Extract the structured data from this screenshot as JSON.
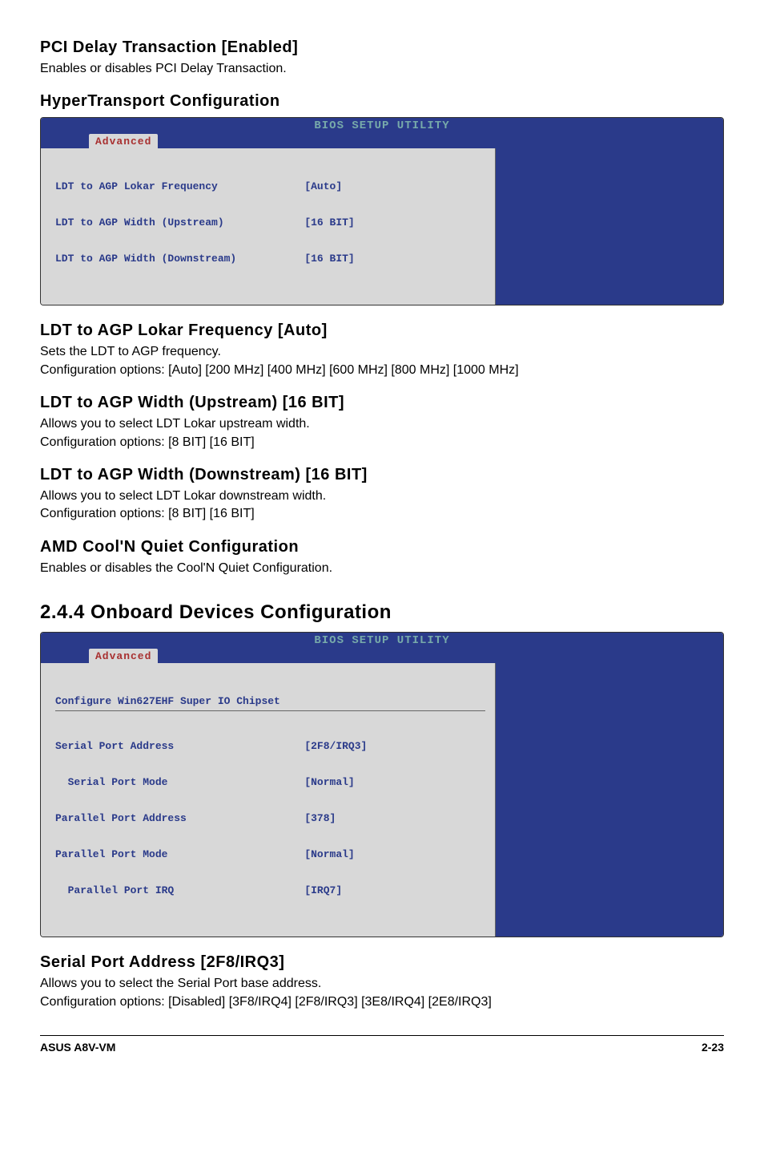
{
  "pci_delay": {
    "title": "PCI Delay Transaction [Enabled]",
    "text": "Enables or disables  PCI Delay Transaction."
  },
  "hyper": {
    "title": "HyperTransport Configuration"
  },
  "bios1": {
    "title": "BIOS SETUP UTILITY",
    "tab": "Advanced",
    "rows": [
      {
        "label": "LDT to AGP Lokar Frequency",
        "value": "[Auto]"
      },
      {
        "label": "LDT to AGP Width (Upstream)",
        "value": "[16 BIT]"
      },
      {
        "label": "LDT to AGP Width (Downstream)",
        "value": "[16 BIT]"
      }
    ]
  },
  "ldt_freq": {
    "title": "LDT to AGP Lokar Frequency [Auto]",
    "text": "Sets the LDT to AGP frequency.\nConfiguration options: [Auto] [200 MHz] [400 MHz] [600 MHz] [800 MHz] [1000 MHz]"
  },
  "ldt_up": {
    "title": "LDT to AGP Width (Upstream) [16 BIT]",
    "text": "Allows you to select LDT Lokar upstream width.\nConfiguration options: [8 BIT] [16 BIT]"
  },
  "ldt_down": {
    "title": "LDT to AGP Width (Downstream) [16 BIT]",
    "text": "Allows you to select LDT Lokar downstream width.\nConfiguration options: [8 BIT] [16 BIT]"
  },
  "amd": {
    "title": "AMD Cool'N Quiet Configuration",
    "text": "Enables or disables the Cool'N Quiet Configuration."
  },
  "section244": {
    "title": "2.4.4   Onboard Devices Configuration"
  },
  "bios2": {
    "title": "BIOS SETUP UTILITY",
    "tab": "Advanced",
    "header": "Configure Win627EHF Super IO Chipset",
    "rows": [
      {
        "label": "Serial Port Address",
        "value": "[2F8/IRQ3]"
      },
      {
        "label": "  Serial Port Mode",
        "value": "[Normal]"
      },
      {
        "label": "Parallel Port Address",
        "value": "[378]"
      },
      {
        "label": "Parallel Port Mode",
        "value": "[Normal]"
      },
      {
        "label": "  Parallel Port IRQ",
        "value": "[IRQ7]"
      }
    ]
  },
  "serial": {
    "title": "Serial Port Address [2F8/IRQ3]",
    "text": "Allows you to select the Serial Port base address.\nConfiguration options: [Disabled] [3F8/IRQ4] [2F8/IRQ3] [3E8/IRQ4] [2E8/IRQ3]"
  },
  "footer": {
    "left": "ASUS A8V-VM",
    "right": "2-23"
  }
}
